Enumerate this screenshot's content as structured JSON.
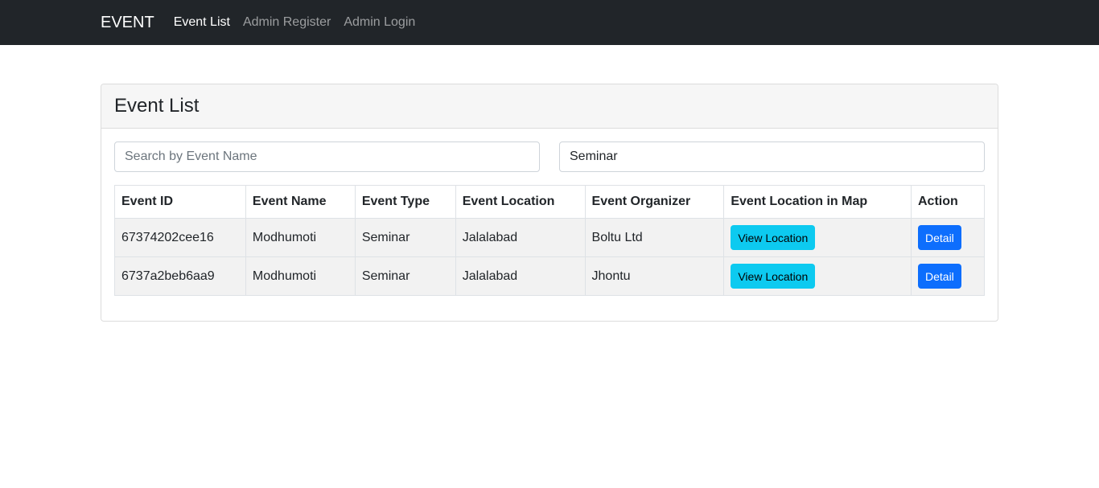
{
  "navbar": {
    "brand": "EVENT",
    "links": [
      {
        "label": "Event List",
        "active": true
      },
      {
        "label": "Admin Register",
        "active": false
      },
      {
        "label": "Admin Login",
        "active": false
      }
    ]
  },
  "card": {
    "title": "Event List",
    "search": {
      "placeholder": "Search by Event Name",
      "value": ""
    },
    "filter": {
      "value": "Seminar"
    }
  },
  "table": {
    "headers": [
      "Event ID",
      "Event Name",
      "Event Type",
      "Event Location",
      "Event Organizer",
      "Event Location in Map",
      "Action"
    ],
    "rows": [
      {
        "id": "67374202cee16",
        "name": "Modhumoti",
        "type": "Seminar",
        "location": "Jalalabad",
        "organizer": "Boltu Ltd",
        "map_button": "View Location",
        "action_button": "Detail"
      },
      {
        "id": "6737a2beb6aa9",
        "name": "Modhumoti",
        "type": "Seminar",
        "location": "Jalalabad",
        "organizer": "Jhontu",
        "map_button": "View Location",
        "action_button": "Detail"
      }
    ]
  },
  "colors": {
    "navbar_bg": "#212529",
    "info_button": "#0dcaf0",
    "primary_button": "#0d6efd"
  }
}
